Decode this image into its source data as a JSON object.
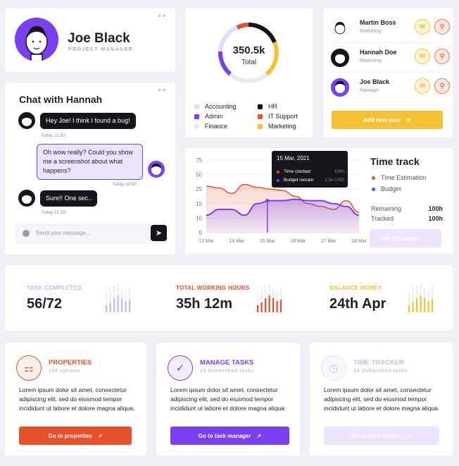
{
  "profile": {
    "name": "Joe Black",
    "role": "PROJECT MANAGER"
  },
  "chat": {
    "title": "Chat with Hannah",
    "messages": [
      {
        "text": "Hey Joe! I think I found a bug!",
        "time": "Today 11:52"
      },
      {
        "text": "Oh wow really? Could you show me a screenshot about what happens?",
        "time": "Today 11:50"
      },
      {
        "text": "Sure!! One sec..",
        "time": "Today 11:59"
      }
    ],
    "input_placeholder": "Send your message..."
  },
  "donut": {
    "value": "350.5k",
    "label": "Total",
    "legend": [
      {
        "label": "Accounting",
        "color": "#e3dcfb"
      },
      {
        "label": "HR",
        "color": "#15151c"
      },
      {
        "label": "Admin",
        "color": "#7a3ff0"
      },
      {
        "label": "IT Support",
        "color": "#e6502a"
      },
      {
        "label": "Finance",
        "color": "#e9e9ef"
      },
      {
        "label": "Marketing",
        "color": "#f5c234"
      }
    ]
  },
  "users": {
    "list": [
      {
        "name": "Martin Boss",
        "role": "Marketing"
      },
      {
        "name": "Hannah Doe",
        "role": "Marketing"
      },
      {
        "name": "Joe Black",
        "role": "Manager"
      }
    ],
    "add_label": "Add new user"
  },
  "timetrack": {
    "title": "Time track",
    "legend": [
      {
        "label": "Time Estimation",
        "color": "#e6502a"
      },
      {
        "label": "Budget",
        "color": "#7a3ff0"
      }
    ],
    "remaining_label": "Remaining",
    "remaining_value": "100h",
    "tracked_label": "Tracked",
    "tracked_value": "100h",
    "report_label": "See full report",
    "tooltip": {
      "date": "15 Mar, 2021",
      "rows": [
        {
          "label": "Time clocked",
          "value": "100h",
          "color": "#e6502a"
        },
        {
          "label": "Budget remain",
          "value": "1.5k USD",
          "color": "#7a3ff0"
        }
      ]
    }
  },
  "chart_data": {
    "type": "area",
    "x": [
      "13 Mar",
      "14 Mar",
      "15 Mar",
      "16 Mar",
      "17 Mar",
      "18 Mar"
    ],
    "y_ticks": [
      75,
      50,
      25,
      15,
      10,
      5
    ],
    "series": [
      {
        "name": "Time Estimation",
        "color": "#e6502a",
        "values": [
          30,
          27,
          22,
          33,
          28,
          25,
          24,
          20,
          15,
          14,
          13,
          17,
          12
        ]
      },
      {
        "name": "Budget",
        "color": "#7a3ff0",
        "values": [
          11,
          13,
          13,
          11,
          15,
          17,
          17,
          18,
          17,
          17,
          15,
          14,
          11
        ]
      }
    ]
  },
  "stats": [
    {
      "label": "TASK COMPLETED",
      "value": "56/72",
      "color": "#c6b8f2"
    },
    {
      "label": "TOTAL WORKING HOURS",
      "value": "35h 12m",
      "color": "#e6502a"
    },
    {
      "label": "BALANCE MONEY",
      "value": "24th Apr",
      "color": "#f5c234"
    }
  ],
  "features": [
    {
      "title": "PROPERTIES",
      "sub": "158 options",
      "body": "Lorem ipsum dolor sit amet, consectetur adipiscing elit, sed do eiusmod tempor incididunt ut labore et dolore magna aliqua.",
      "button": "Go to properties",
      "color": "#e6502a",
      "icon": "properties-icon"
    },
    {
      "title": "MANAGE TASKS",
      "sub": "23 Unfinished tasks",
      "body": "Lorem ipsum dolor sit amet, consectetur adipiscing elit, sed do eiusmod tempor incididunt ut labore et dolore magna aliqua.",
      "button": "Go to task manager",
      "color": "#7a3ff0",
      "icon": "check-badge-icon"
    },
    {
      "title": "TIME TRACKER",
      "sub": "23 Unfinished tasks",
      "body": "Lorem ipsum dolor sit amet, consectetur adipiscing elit, sed do eiusmod tempor incididunt ut labore et dolore magna aliqua.",
      "button": "Go to time tracker",
      "color": "#c6b8f2",
      "icon": "clock-icon"
    }
  ]
}
